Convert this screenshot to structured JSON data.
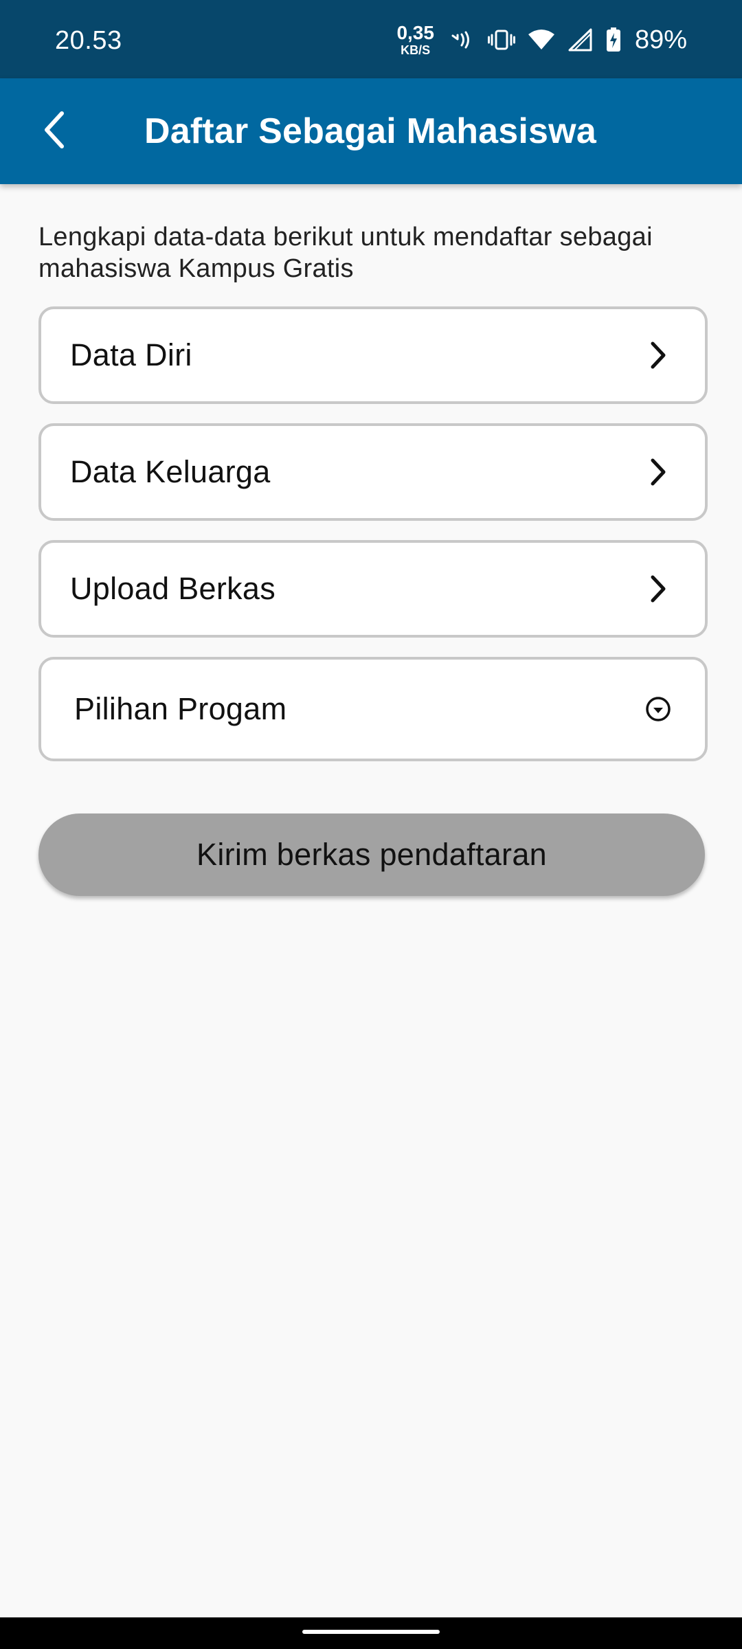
{
  "status_bar": {
    "time": "20.53",
    "net_speed_value": "0,35",
    "net_speed_unit": "KB/S",
    "battery_percent": "89%",
    "icons": [
      "nfc-icon",
      "vibrate-icon",
      "wifi-icon",
      "cell-signal-icon",
      "battery-charging-icon"
    ]
  },
  "app_bar": {
    "title": "Daftar Sebagai Mahasiswa",
    "back_icon": "back-arrow-icon",
    "background": "#0168a0"
  },
  "intro_text": "Lengkapi data-data berikut untuk mendaftar sebagai mahasiswa Kampus Gratis",
  "menu_items": [
    {
      "label": "Data Diri",
      "icon": "chevron-right-icon"
    },
    {
      "label": "Data Keluarga",
      "icon": "chevron-right-icon"
    },
    {
      "label": "Upload Berkas",
      "icon": "chevron-right-icon"
    },
    {
      "label": "Pilihan Progam",
      "icon": "chevron-down-circle-icon"
    }
  ],
  "submit_button": {
    "label": "Kirim berkas pendaftaran",
    "color": "#a2a2a2",
    "state": "disabled"
  }
}
